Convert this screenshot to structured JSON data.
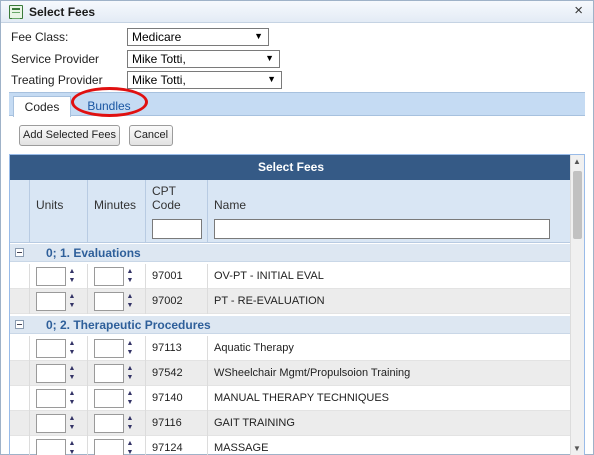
{
  "dialog": {
    "title": "Select Fees",
    "close_glyph": "×"
  },
  "form": {
    "fee_class": {
      "label": "Fee Class:",
      "value": "Medicare"
    },
    "service_provider": {
      "label": "Service Provider",
      "value": "Mike Totti,"
    },
    "treating_provider": {
      "label": "Treating Provider",
      "value": "Mike Totti,"
    },
    "dropdown_glyph": "▼"
  },
  "tabs": [
    {
      "label": "Codes",
      "active": true
    },
    {
      "label": "Bundles",
      "active": false
    }
  ],
  "buttons": {
    "add_selected": "Add Selected Fees",
    "cancel": "Cancel"
  },
  "grid": {
    "caption": "Select Fees",
    "columns": {
      "units": "Units",
      "minutes": "Minutes",
      "cpt_code_line1": "CPT",
      "cpt_code_line2": "Code",
      "name": "Name"
    },
    "filter": {
      "code_value": "",
      "name_value": ""
    },
    "groups": [
      {
        "label": "0; 1. Evaluations",
        "rows": [
          {
            "code": "97001",
            "name": "OV-PT - INITIAL EVAL"
          },
          {
            "code": "97002",
            "name": "PT - RE-EVALUATION"
          }
        ]
      },
      {
        "label": "0; 2. Therapeutic Procedures",
        "rows": [
          {
            "code": "97113",
            "name": "Aquatic Therapy"
          },
          {
            "code": "97542",
            "name": "WSheelchair Mgmt/Propulsoion Training"
          },
          {
            "code": "97140",
            "name": "MANUAL THERAPY TECHNIQUES"
          },
          {
            "code": "97116",
            "name": "GAIT TRAINING"
          },
          {
            "code": "97124",
            "name": "MASSAGE"
          }
        ]
      }
    ],
    "spinner_up": "▲",
    "spinner_down": "▼"
  },
  "icons": {
    "title_icon": "fee-list-icon",
    "collapse_icon": "collapse-minus-icon"
  },
  "colors": {
    "caption_bg": "#355a86",
    "tab_bar": "#c5dbf3",
    "highlight_ring": "#e01010",
    "group_text": "#2e5f9a"
  }
}
